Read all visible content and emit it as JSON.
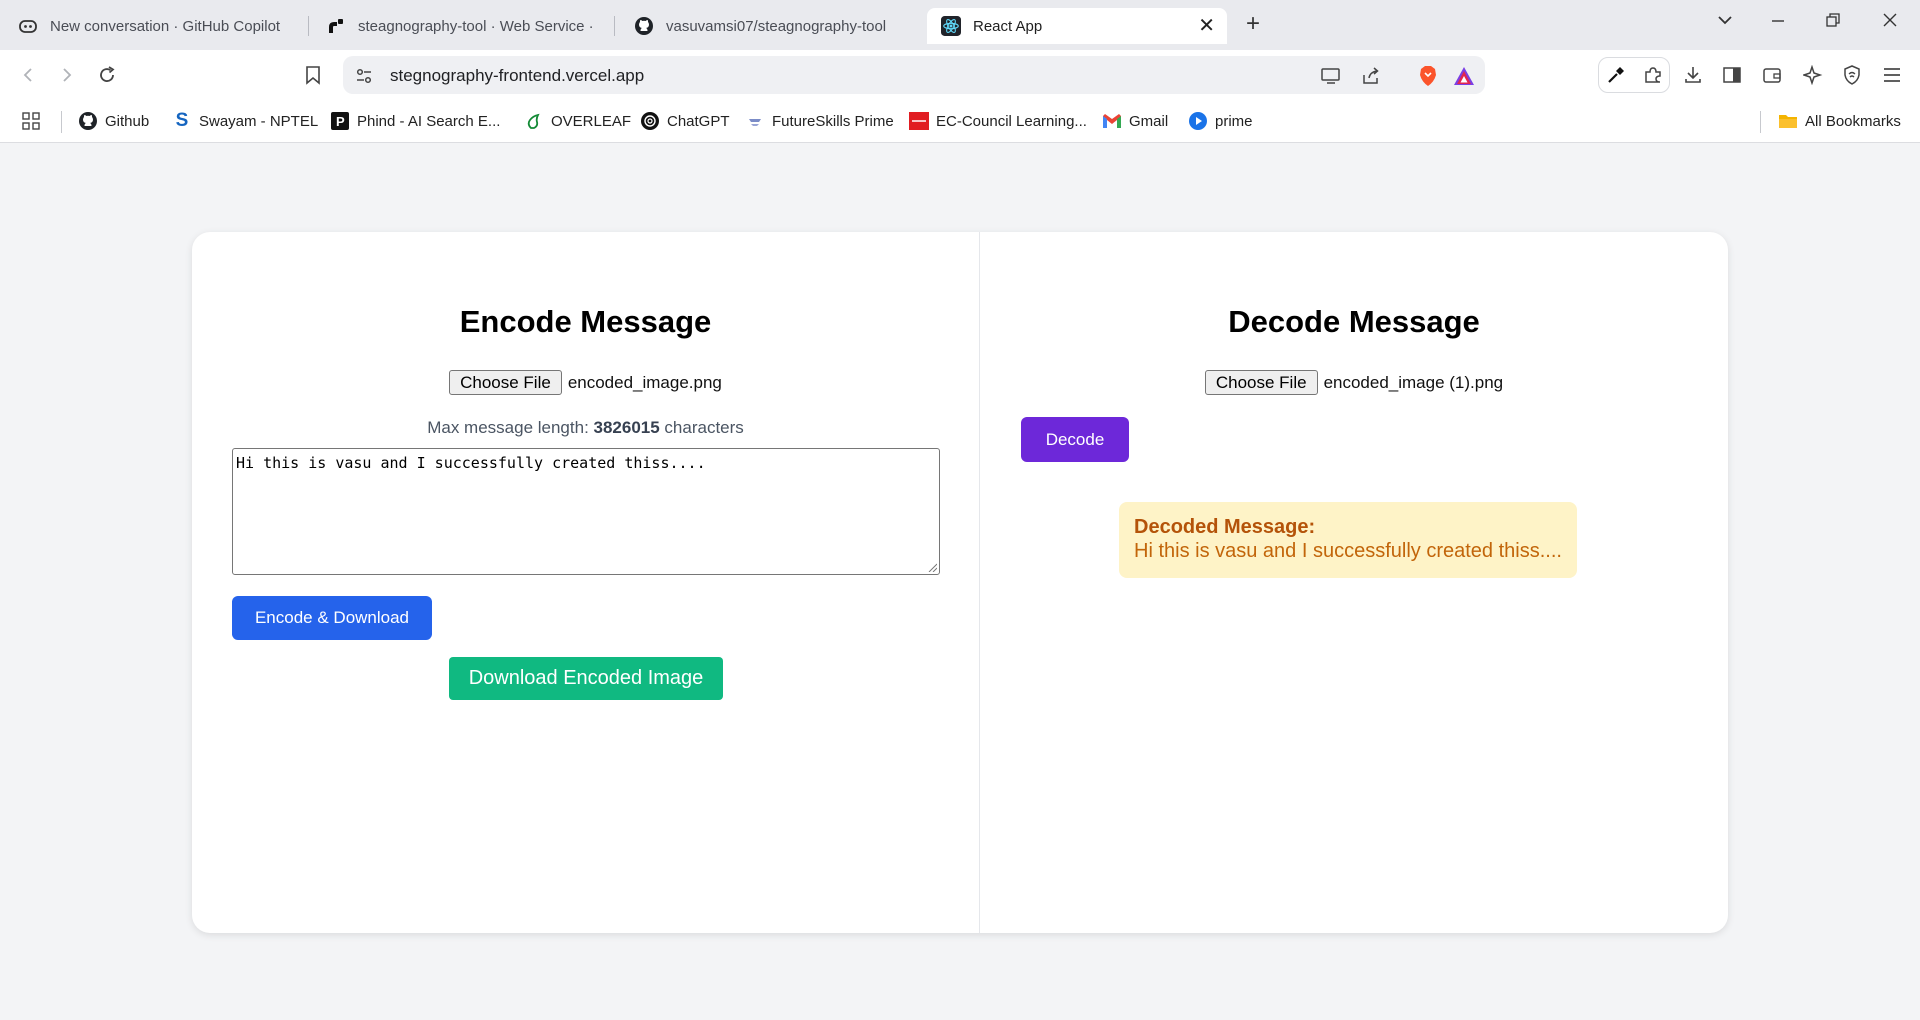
{
  "browser": {
    "tabs": [
      {
        "title": "New conversation · GitHub Copilot",
        "icon": "copilot-icon"
      },
      {
        "title": "steagnography-tool · Web Service ·",
        "icon": "render-icon"
      },
      {
        "title": "vasuvamsi07/steagnography-tool",
        "icon": "github-icon"
      },
      {
        "title": "React App",
        "icon": "react-icon",
        "active": true
      }
    ],
    "url": "stegnography-frontend.vercel.app",
    "bookmarks": [
      {
        "label": "Github",
        "icon": "github-icon"
      },
      {
        "label": "Swayam - NPTEL",
        "icon": "swayam-icon"
      },
      {
        "label": "Phind - AI Search E...",
        "icon": "phind-icon"
      },
      {
        "label": "OVERLEAF",
        "icon": "overleaf-icon"
      },
      {
        "label": "ChatGPT",
        "icon": "chatgpt-icon"
      },
      {
        "label": "FutureSkills Prime",
        "icon": "futureskills-icon"
      },
      {
        "label": "EC-Council Learning...",
        "icon": "eccouncil-icon"
      },
      {
        "label": "Gmail",
        "icon": "gmail-icon"
      },
      {
        "label": "prime",
        "icon": "prime-icon"
      }
    ],
    "all_bookmarks_label": "All Bookmarks"
  },
  "encode": {
    "title": "Encode Message",
    "choose_file_label": "Choose File",
    "file_name": "encoded_image.png",
    "max_length_prefix": "Max message length: ",
    "max_length_value": "3826015",
    "max_length_suffix": " characters",
    "message_value": "Hi this is vasu and I successfully created thiss....",
    "encode_button_label": "Encode & Download",
    "download_button_label": "Download Encoded Image"
  },
  "decode": {
    "title": "Decode Message",
    "choose_file_label": "Choose File",
    "file_name": "encoded_image (1).png",
    "decode_button_label": "Decode",
    "result_title": "Decoded Message:",
    "result_text": "Hi this is vasu and I successfully created thiss...."
  },
  "colors": {
    "encode_button": "#2563eb",
    "download_button": "#10b981",
    "decode_button": "#6d28d9",
    "result_background": "#fef3c7",
    "result_text": "#b45309"
  }
}
